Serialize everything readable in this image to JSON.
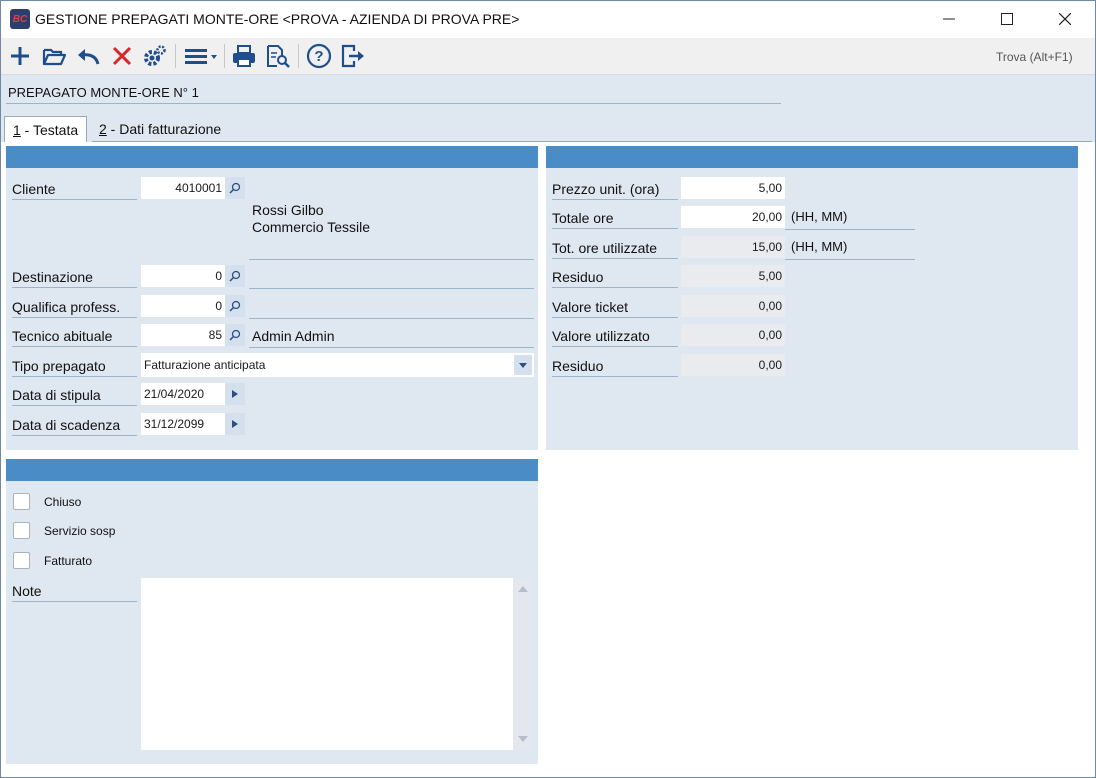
{
  "window": {
    "icon_text": "BC",
    "title": "GESTIONE PREPAGATI MONTE-ORE <PROVA - AZIENDA DI PROVA PRE>"
  },
  "toolbar": {
    "icons": [
      "add-icon",
      "open-folder-icon",
      "undo-icon",
      "delete-icon",
      "settings-icon",
      "menu-icon",
      "print-icon",
      "print-preview-icon",
      "help-icon",
      "exit-icon"
    ],
    "find_label": "Trova (Alt+F1)"
  },
  "header": {
    "record_title": "PREPAGATO MONTE-ORE N° 1"
  },
  "tabs": [
    {
      "key": "1",
      "rest": " - Testata",
      "active": true
    },
    {
      "key": "2",
      "rest": " - Dati fatturazione",
      "active": false
    }
  ],
  "left_panel": {
    "cliente": {
      "label": "Cliente",
      "value": "4010001",
      "desc_line1": "Rossi Gilbo",
      "desc_line2": "Commercio Tessile"
    },
    "destinazione": {
      "label": "Destinazione",
      "value": "0",
      "desc": ""
    },
    "qualifica": {
      "label": "Qualifica profess.",
      "value": "0",
      "desc": ""
    },
    "tecnico": {
      "label": "Tecnico abituale",
      "value": "85",
      "desc": "Admin Admin"
    },
    "tipo_prepagato": {
      "label": "Tipo prepagato",
      "value": "Fatturazione anticipata"
    },
    "data_stipula": {
      "label": "Data di stipula",
      "value": "21/04/2020"
    },
    "data_scadenza": {
      "label": "Data di scadenza",
      "value": "31/12/2099"
    }
  },
  "right_panel": {
    "prezzo_unit": {
      "label": "Prezzo unit. (ora)",
      "value": "5,00"
    },
    "totale_ore": {
      "label": "Totale ore",
      "value": "20,00",
      "unit": "(HH, MM)"
    },
    "tot_ore_utilizzate": {
      "label": "Tot. ore utilizzate",
      "value": "15,00",
      "unit": "(HH, MM)"
    },
    "residuo_ore": {
      "label": "Residuo",
      "value": "5,00"
    },
    "valore_ticket": {
      "label": "Valore ticket",
      "value": "0,00"
    },
    "valore_utilizzato": {
      "label": "Valore utilizzato",
      "value": "0,00"
    },
    "residuo_valore": {
      "label": "Residuo",
      "value": "0,00"
    }
  },
  "bottom_panel": {
    "chiuso": {
      "label": "Chiuso",
      "checked": false
    },
    "servizio_sosp": {
      "label": "Servizio sosp",
      "checked": false
    },
    "fatturato": {
      "label": "Fatturato",
      "checked": false
    },
    "note": {
      "label": "Note",
      "value": ""
    }
  },
  "colors": {
    "panel_header": "#4a8cc6",
    "panel_bg": "#dfe7f1",
    "toolbar_icon": "#1f4e8c",
    "delete_icon": "#d9262c"
  }
}
